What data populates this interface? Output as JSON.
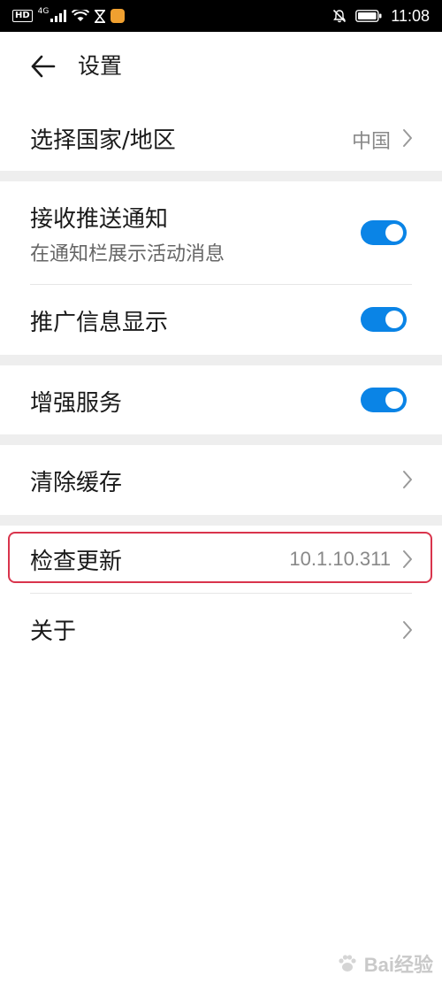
{
  "status_bar": {
    "left_badge": "HD",
    "network": "4G",
    "time": "11:08",
    "icons": [
      "hd-icon",
      "signal-icon",
      "wifi-icon",
      "hourglass-icon",
      "app-notification-icon",
      "mute-icon",
      "battery-icon"
    ]
  },
  "header": {
    "title": "设置",
    "back_icon": "arrow-left-icon"
  },
  "rows": {
    "region": {
      "label": "选择国家/地区",
      "value": "中国"
    },
    "push": {
      "label": "接收推送通知",
      "sub": "在通知栏展示活动消息",
      "enabled": true
    },
    "promo": {
      "label": "推广信息显示",
      "enabled": true
    },
    "enhanced": {
      "label": "增强服务",
      "enabled": true
    },
    "cache": {
      "label": "清除缓存"
    },
    "update": {
      "label": "检查更新",
      "value": "10.1.10.311"
    },
    "about": {
      "label": "关于"
    }
  },
  "colors": {
    "toggle_on": "#0a84e6",
    "highlight": "#d9344c",
    "section_gap": "#eeeeee"
  },
  "watermark": {
    "text": "Bai经验"
  }
}
